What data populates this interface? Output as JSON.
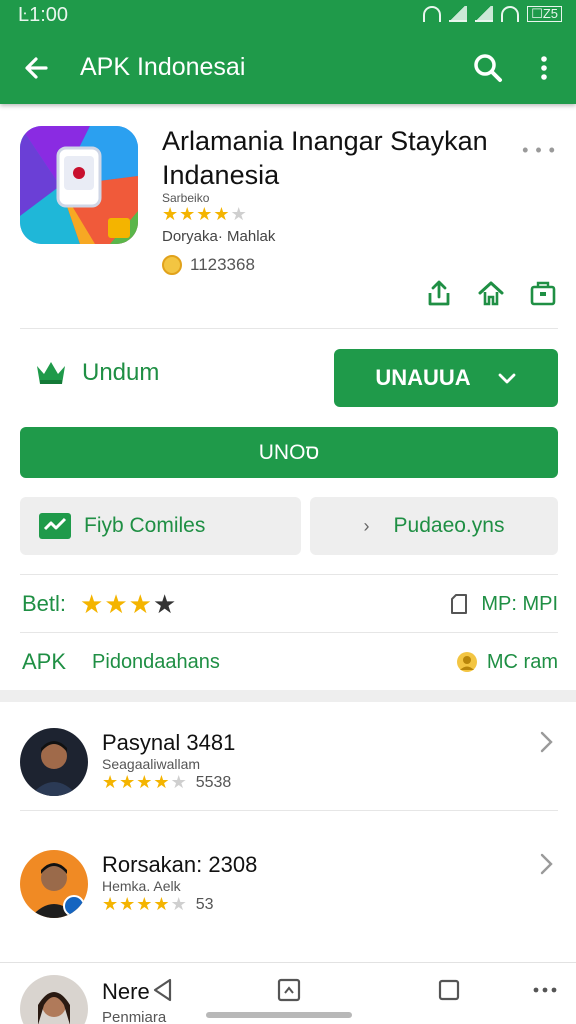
{
  "status_bar": {
    "time": "Ŀ1:00",
    "battery": "☐Z5"
  },
  "app_bar": {
    "title": "APK Indonesai"
  },
  "app": {
    "name": "Arlamania Inangar Staykan Indanesia",
    "developer": "Sarbeiko",
    "rating_stars": 4.5,
    "meta": "Doryaka· Mahlak",
    "downloads": "1123368"
  },
  "install": {
    "wishlist_label": "Undum",
    "primary_button": "UNAUUA",
    "wide_button": "UNOס",
    "secondary_left": "Fiyb Comiles",
    "secondary_right": "Pudaeo.yns"
  },
  "info": {
    "rating_label": "Betl:",
    "rating_stars": 3,
    "rating_right": "MP: MPI",
    "apk_label": "APK",
    "apk_value": "Pidondaahans",
    "apk_right": "MC ram"
  },
  "reviewers": [
    {
      "name": "Pasynal 3481",
      "sub": "Seagaaliwallam",
      "stars": 4.5,
      "count": "5538"
    },
    {
      "name": "Rorsakan: 2308",
      "sub": "Hemka. Aelk",
      "stars": 3.5,
      "count": "53"
    },
    {
      "name": "Nere",
      "sub": "Penmiara"
    }
  ],
  "colors": {
    "brand_green": "#1f9a4a",
    "star": "#f4b400"
  }
}
